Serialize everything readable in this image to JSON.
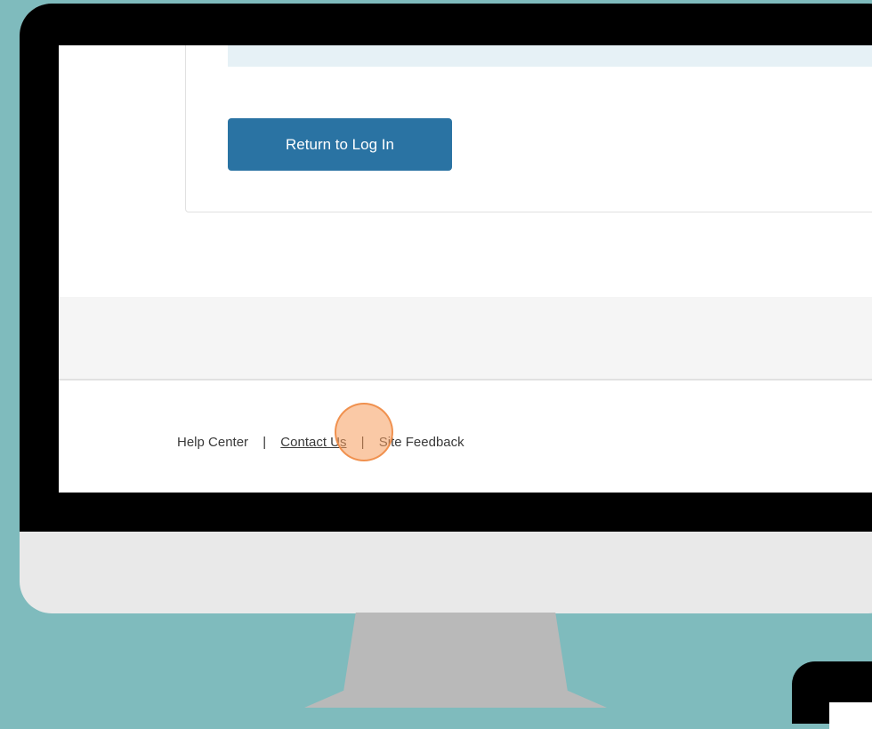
{
  "login_card": {
    "return_button_label": "Return to Log In"
  },
  "footer": {
    "links": [
      "Help Center",
      "Contact Us",
      "Site Feedback"
    ],
    "separator": "|"
  },
  "colors": {
    "background": "#7fbbbd",
    "button": "#2a73a3",
    "click_marker": "#f59c5c"
  },
  "icons": {
    "click_marker": "click-indicator-icon"
  }
}
